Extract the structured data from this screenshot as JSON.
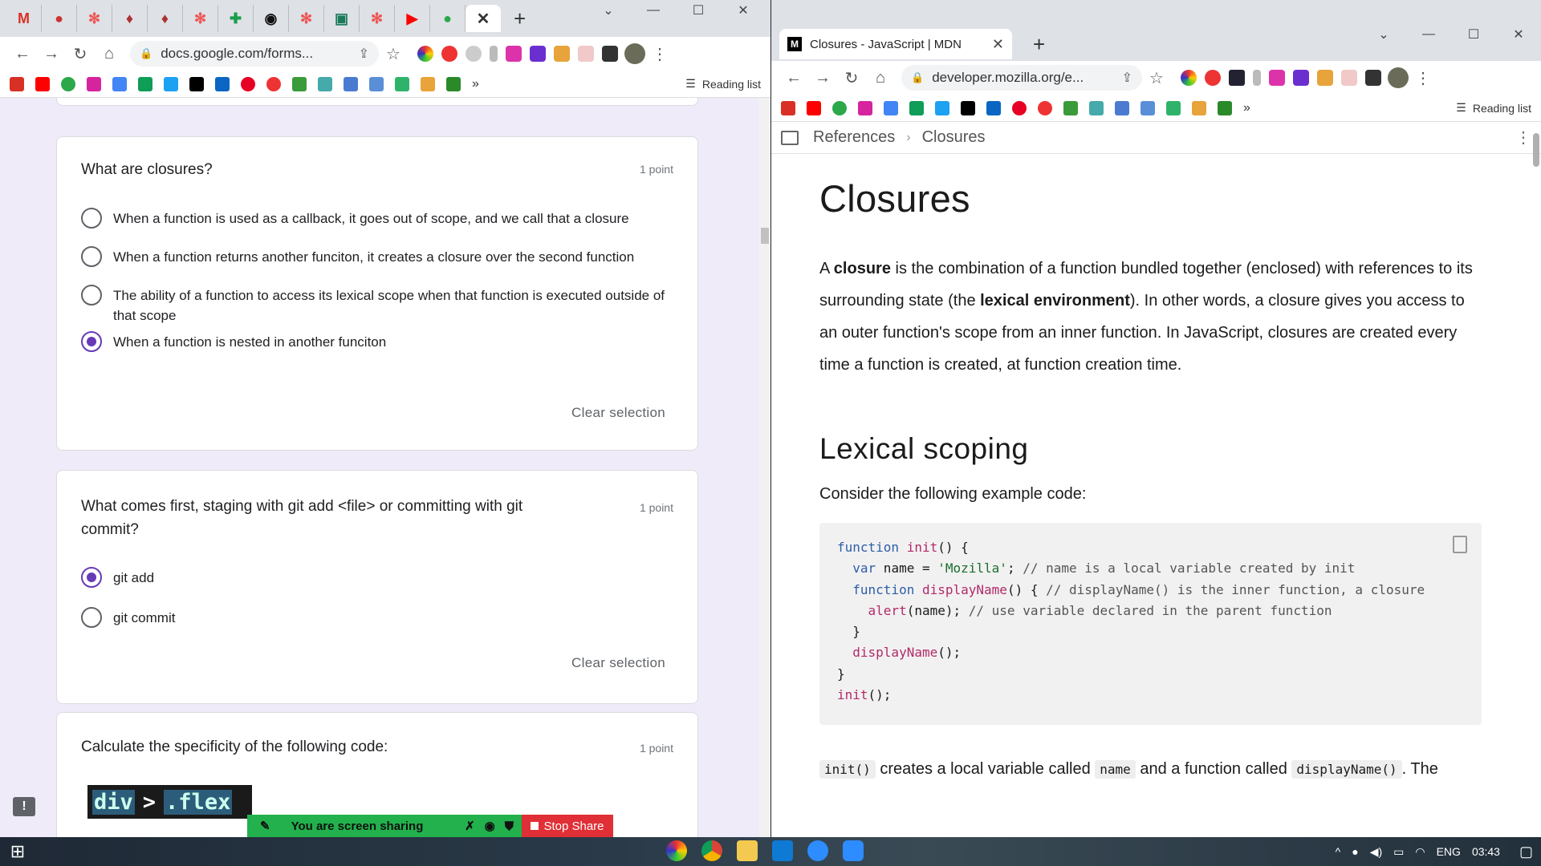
{
  "left_window": {
    "tab_close": "✕",
    "new_tab": "+",
    "url": "docs.google.com/forms...",
    "reading_list": "Reading list",
    "bookmarks_more": "»",
    "questions": [
      {
        "title": "What are closures?",
        "points": "1 point",
        "options": [
          {
            "text": "When a function is used as a callback, it goes out of scope, and we call that a closure",
            "selected": false
          },
          {
            "text": "When a function returns another funciton, it creates a closure over the second function",
            "selected": false
          },
          {
            "text": "The ability of a function to access its lexical scope when that function is executed outside of that scope",
            "selected": false
          },
          {
            "text": "When a function is nested in another funciton",
            "selected": true
          }
        ],
        "clear": "Clear selection"
      },
      {
        "title": "What comes first, staging with git add <file> or committing with git commit?",
        "points": "1 point",
        "options": [
          {
            "text": "git add",
            "selected": true
          },
          {
            "text": "git commit",
            "selected": false
          }
        ],
        "clear": "Clear selection"
      },
      {
        "title": "Calculate the specificity of the following code:",
        "points": "1 point",
        "code_image": {
          "part1": "div",
          "part2": ">",
          "part3": ".flex"
        }
      }
    ],
    "screen_share": {
      "text": "You are screen sharing",
      "stop": "Stop Share"
    }
  },
  "right_window": {
    "tab_title": "Closures - JavaScript | MDN",
    "tab_favicon": "M",
    "tab_close": "✕",
    "new_tab": "+",
    "url": "developer.mozilla.org/e...",
    "reading_list": "Reading list",
    "bookmarks_more": "»",
    "breadcrumb": [
      "References",
      "Closures"
    ],
    "heading": "Closures",
    "intro": {
      "a": "A ",
      "b1": "closure",
      "c": " is the combination of a function bundled together (enclosed) with references to its surrounding state (the ",
      "b2": "lexical environment",
      "d": "). In other words, a closure gives you access to an outer function's scope from an inner function. In JavaScript, closures are created every time a function is created, at function creation time."
    },
    "h2": "Lexical scoping",
    "p2": "Consider the following example code:",
    "code_lines": [
      "function init() {",
      "  var name = 'Mozilla'; // name is a local variable created by init",
      "  function displayName() { // displayName() is the inner function, a closure",
      "    alert(name); // use variable declared in the parent function",
      "  }",
      "  displayName();",
      "}",
      "init();"
    ],
    "p3": {
      "c1": "init()",
      "t1": " creates a local variable called ",
      "c2": "name",
      "t2": " and a function called ",
      "c3": "displayName()",
      "t3": ". The"
    }
  },
  "taskbar": {
    "lang": "ENG",
    "time": "03:43"
  },
  "colors": {
    "forms_accent": "#673ab7",
    "forms_bg": "#f0ebf8",
    "share_green": "#22b14c",
    "stop_red": "#e02f36"
  }
}
